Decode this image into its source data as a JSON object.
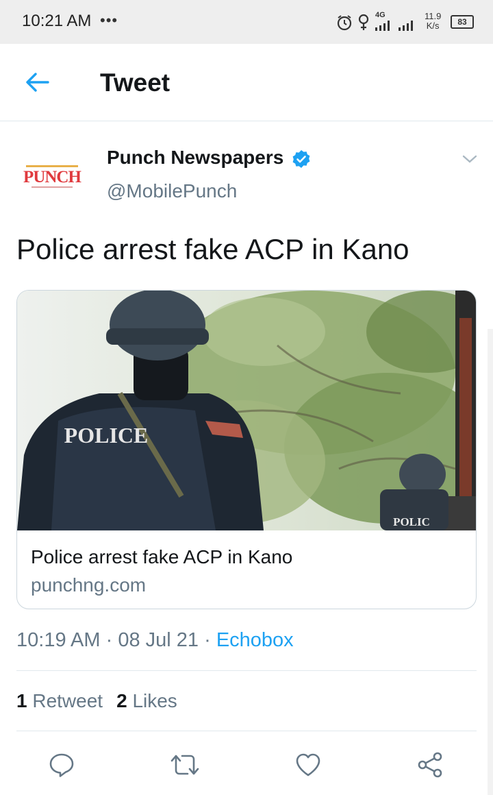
{
  "status_bar": {
    "time": "10:21 AM",
    "dots": "•••",
    "network": "4G",
    "speed_value": "11.9",
    "speed_unit": "K/s",
    "battery": "83"
  },
  "header": {
    "title": "Tweet",
    "back_icon": "arrow-left-icon"
  },
  "tweet": {
    "author_name": "Punch Newspapers",
    "handle": "@MobilePunch",
    "verified": true,
    "avatar_logo_text": "PUNCH",
    "text": "Police arrest fake ACP in Kano",
    "card": {
      "image_text_main": "POLICE",
      "image_text_small": "POLIC",
      "title": "Police arrest fake ACP in Kano",
      "domain": "punchng.com"
    },
    "time": "10:19 AM",
    "separator": "·",
    "date": "08 Jul 21",
    "source": "Echobox",
    "retweets_count": "1",
    "retweets_label": "Retweet",
    "likes_count": "2",
    "likes_label": "Likes"
  },
  "actions": [
    "reply-icon",
    "retweet-icon",
    "like-icon",
    "share-icon"
  ],
  "colors": {
    "accent": "#1da1f2",
    "text": "#14171a",
    "muted": "#657786",
    "punch_red": "#e03a3e"
  }
}
